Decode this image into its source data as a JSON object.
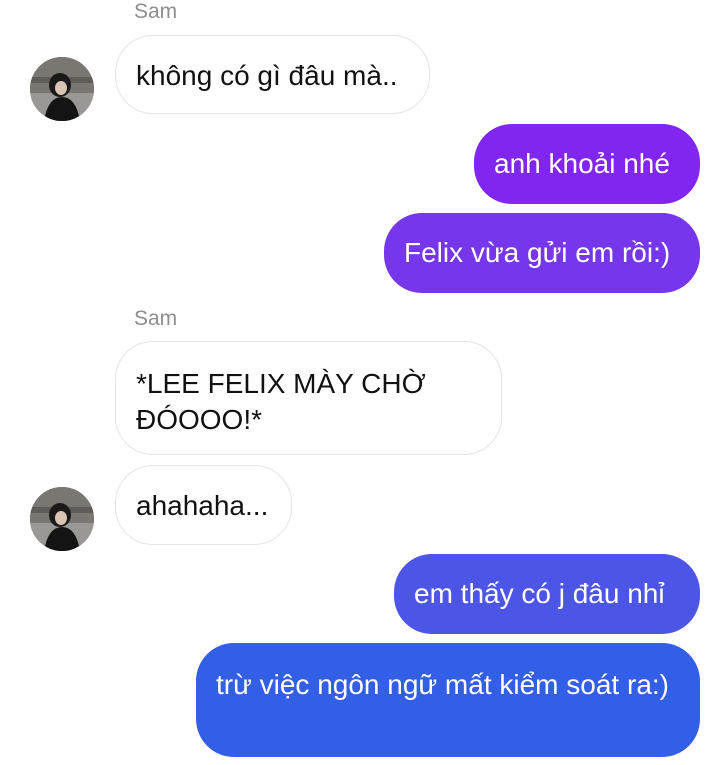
{
  "conversation": {
    "contact_name": "Sam",
    "messages": [
      {
        "direction": "incoming",
        "text": "không có gì đâu mà.."
      },
      {
        "direction": "outgoing",
        "text": "anh khoải nhé",
        "color": "#8125f0"
      },
      {
        "direction": "outgoing",
        "text": "Felix vừa gửi em rồi:)",
        "color": "#7636ec"
      },
      {
        "direction": "incoming",
        "text": "*LEE FELIX MÀY CHỜ ĐÓOOO!*"
      },
      {
        "direction": "incoming",
        "text": "ahahaha..."
      },
      {
        "direction": "outgoing",
        "text": "em thấy có j đâu nhỉ",
        "color": "#4d55e6"
      },
      {
        "direction": "outgoing",
        "text": "trừ việc ngôn ngữ mất kiểm soát ra:)",
        "color": "#335ee6"
      }
    ]
  },
  "colors": {
    "incoming_bubble": "#ffffff",
    "incoming_border": "#e4e4e4",
    "sender_label": "#8e8e8e"
  },
  "icons": {
    "avatar": "contact-avatar-photo"
  }
}
